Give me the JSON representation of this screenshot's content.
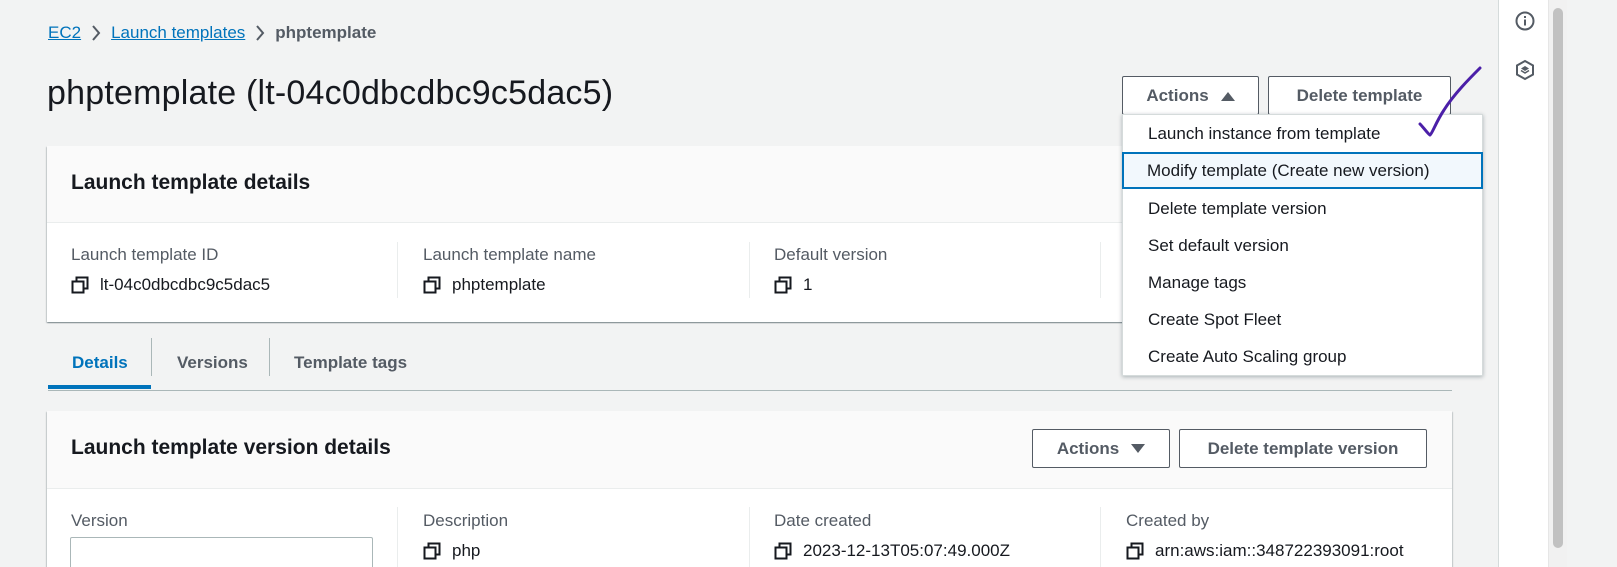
{
  "breadcrumb": {
    "items": [
      "EC2",
      "Launch templates"
    ],
    "current": "phptemplate"
  },
  "page": {
    "title": "phptemplate (lt-04c0dbcdbc9c5dac5)"
  },
  "header_buttons": {
    "actions": "Actions",
    "delete": "Delete template"
  },
  "details_panel": {
    "title": "Launch template details",
    "fields": [
      {
        "label": "Launch template ID",
        "value": "lt-04c0dbcdbc9c5dac5"
      },
      {
        "label": "Launch template name",
        "value": "phptemplate"
      },
      {
        "label": "Default version",
        "value": "1"
      }
    ]
  },
  "tabs": [
    "Details",
    "Versions",
    "Template tags"
  ],
  "version_panel": {
    "title": "Launch template version details",
    "actions": "Actions",
    "delete": "Delete template version",
    "fields": [
      {
        "label": "Version",
        "value": ""
      },
      {
        "label": "Description",
        "value": "php"
      },
      {
        "label": "Date created",
        "value": "2023-12-13T05:07:49.000Z"
      },
      {
        "label": "Created by",
        "value": "arn:aws:iam::348722393091:root"
      }
    ]
  },
  "actions_menu": {
    "items": [
      "Launch instance from template",
      "Modify template (Create new version)",
      "Delete template version",
      "Set default version",
      "Manage tags",
      "Create Spot Fleet",
      "Create Auto Scaling group"
    ],
    "highlighted_index": 1
  },
  "rail": {
    "icons": [
      "info-icon",
      "settings-hexagon-icon"
    ]
  },
  "colors": {
    "link": "#0073bb",
    "annotation": "#4b1fa8",
    "background": "#f2f3f3"
  }
}
